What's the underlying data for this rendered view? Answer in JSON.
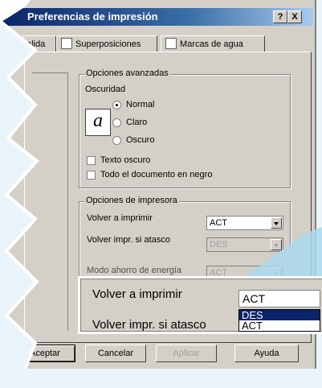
{
  "window": {
    "title": "Preferencias de impresión",
    "help_button": "?",
    "close_button": "X"
  },
  "tabs": [
    {
      "label": "alida"
    },
    {
      "label": "Superposiciones"
    },
    {
      "label": "Marcas de agua"
    }
  ],
  "advanced": {
    "legend": "Opciones avanzadas",
    "darkness_label": "Oscuridad",
    "doc_icon_glyph": "a",
    "radios": [
      {
        "label": "Normal",
        "checked": true
      },
      {
        "label": "Claro",
        "checked": false
      },
      {
        "label": "Oscuro",
        "checked": false
      }
    ],
    "checkboxes": [
      {
        "label": "Texto oscuro",
        "checked": false
      },
      {
        "label": "Todo el documento en negro",
        "checked": false
      }
    ]
  },
  "printer": {
    "legend": "Opciones de impresora",
    "reprint_label": "Volver a imprimir",
    "reprint_value": "ACT",
    "jam_label": "Volver impr. si atasco",
    "jam_value": "DES",
    "eco_label": "Modo ahorro de energía",
    "eco_value": "ACT"
  },
  "zoom_callout": {
    "reprint_label": "Volver a imprimir",
    "reprint_value": "ACT",
    "jam_label": "Volver impr. si atasco",
    "options": [
      {
        "label": "DES",
        "selected": true
      },
      {
        "label": "ACT",
        "selected": false
      }
    ]
  },
  "buttons": {
    "accept": "Aceptar",
    "cancel": "Cancelar",
    "apply": "Aplicar",
    "help": "Ayuda"
  },
  "colors": {
    "title_bar": "#0a246a",
    "dialog_face": "#d4d0c8",
    "selection": "#0a246a",
    "backdrop": "#e9f5fb"
  }
}
